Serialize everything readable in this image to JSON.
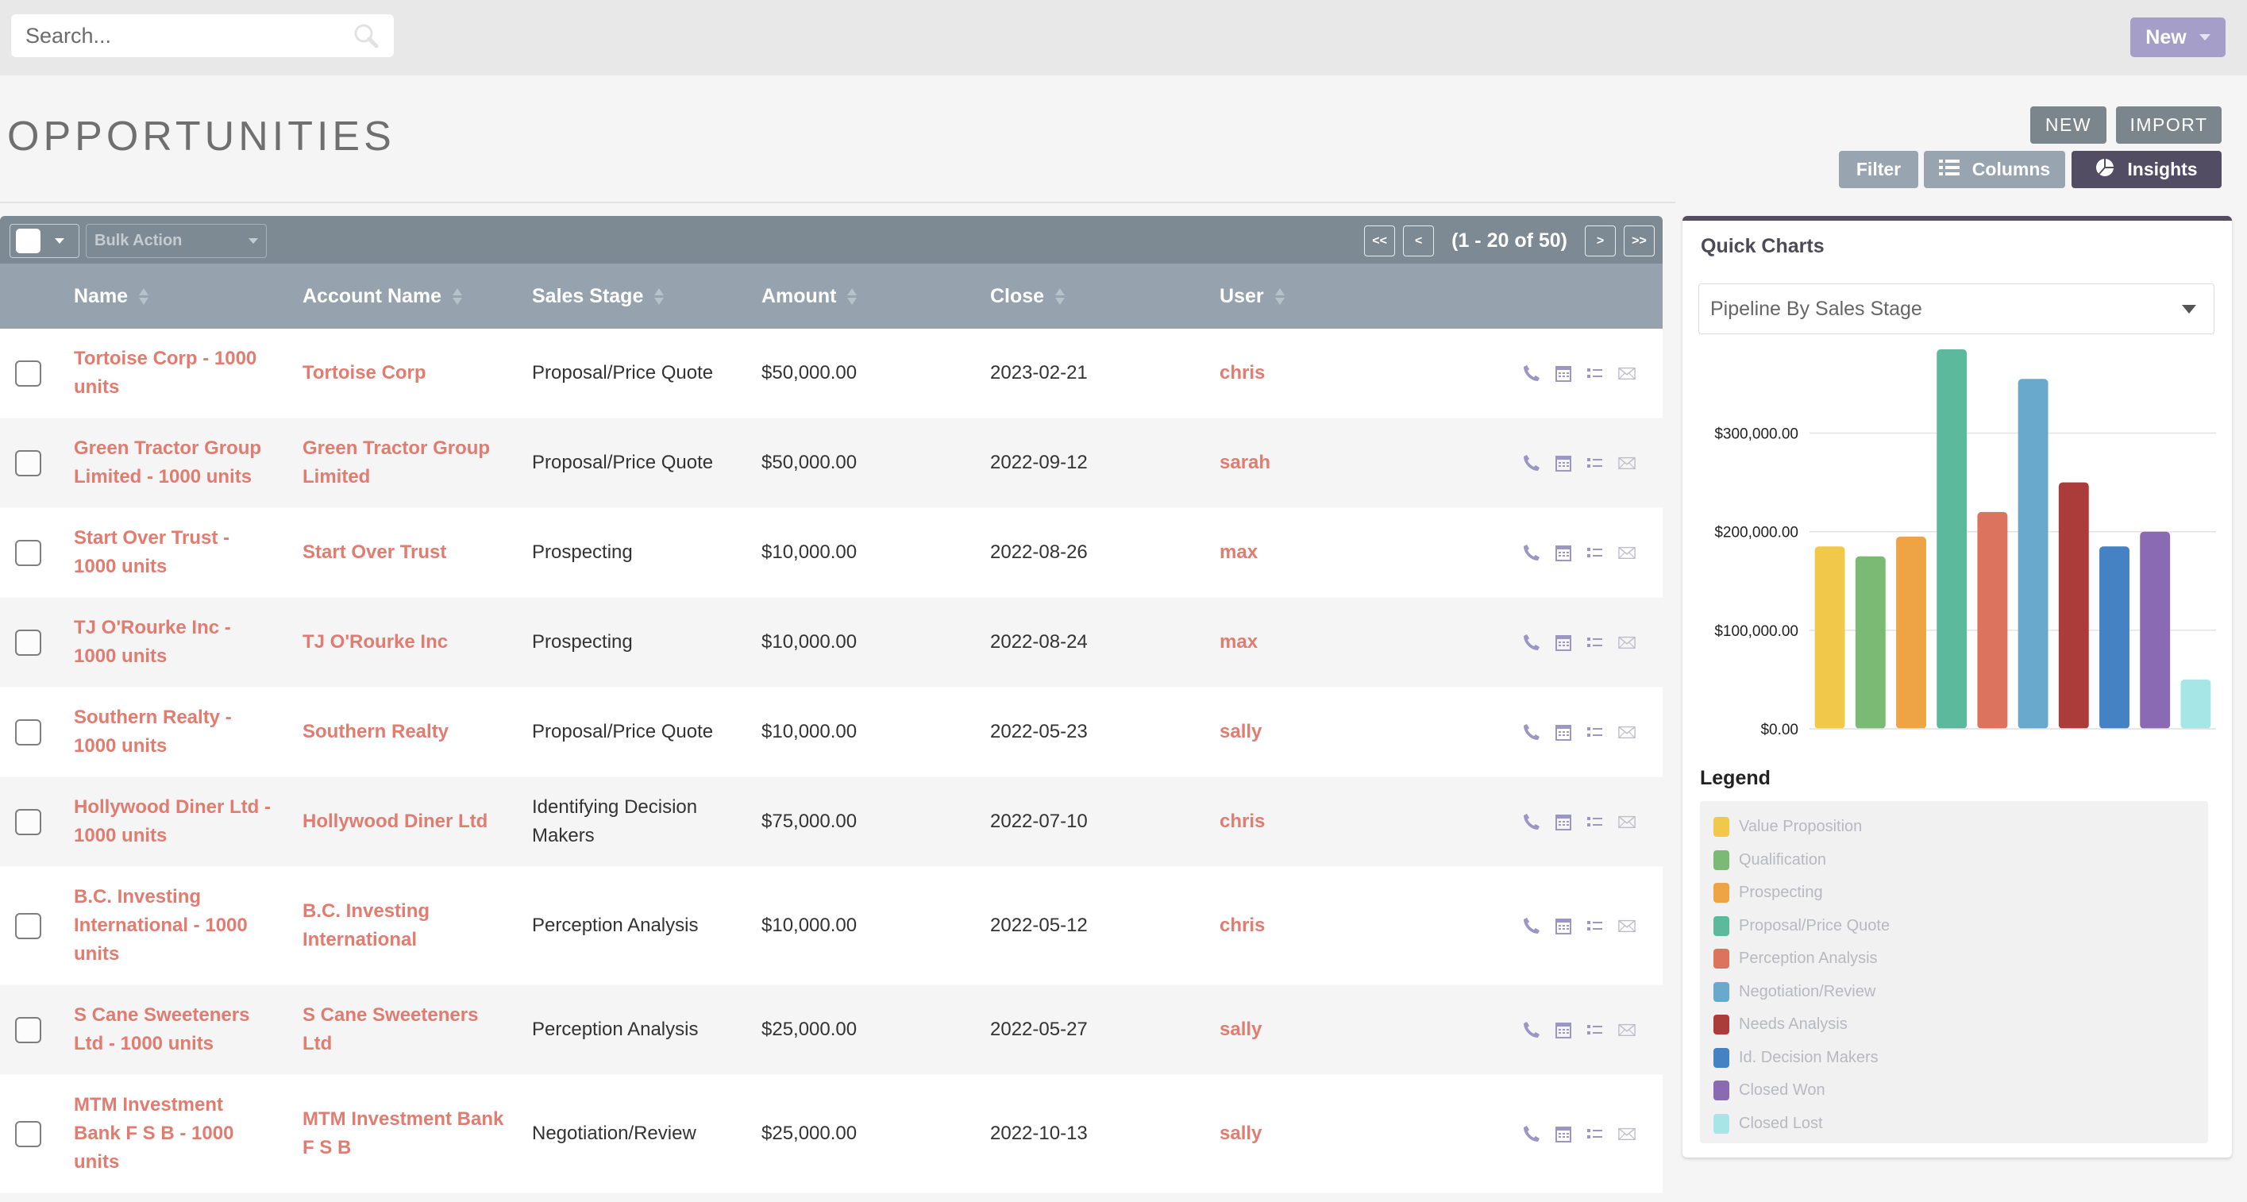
{
  "topbar": {
    "search_placeholder": "Search...",
    "new_label": "New"
  },
  "page": {
    "title": "OPPORTUNITIES",
    "buttons": {
      "new": "NEW",
      "import": "IMPORT",
      "filter": "Filter",
      "columns": "Columns",
      "insights": "Insights"
    }
  },
  "list": {
    "bulk_action": "Bulk Action",
    "pagination": {
      "first": "<<",
      "prev": "<",
      "count": "(1 - 20 of 50)",
      "next": ">",
      "last": ">>"
    },
    "columns": [
      "Name",
      "Account Name",
      "Sales Stage",
      "Amount",
      "Close",
      "User"
    ],
    "rows": [
      {
        "name": "Tortoise Corp - 1000 units",
        "account": "Tortoise Corp",
        "stage": "Proposal/Price Quote",
        "amount": "$50,000.00",
        "close": "2023-02-21",
        "user": "chris"
      },
      {
        "name": "Green Tractor Group Limited - 1000 units",
        "account": "Green Tractor Group Limited",
        "stage": "Proposal/Price Quote",
        "amount": "$50,000.00",
        "close": "2022-09-12",
        "user": "sarah"
      },
      {
        "name": "Start Over Trust - 1000 units",
        "account": "Start Over Trust",
        "stage": "Prospecting",
        "amount": "$10,000.00",
        "close": "2022-08-26",
        "user": "max"
      },
      {
        "name": "TJ O'Rourke Inc - 1000 units",
        "account": "TJ O'Rourke Inc",
        "stage": "Prospecting",
        "amount": "$10,000.00",
        "close": "2022-08-24",
        "user": "max"
      },
      {
        "name": "Southern Realty - 1000 units",
        "account": "Southern Realty",
        "stage": "Proposal/Price Quote",
        "amount": "$10,000.00",
        "close": "2022-05-23",
        "user": "sally"
      },
      {
        "name": "Hollywood Diner Ltd - 1000 units",
        "account": "Hollywood Diner Ltd",
        "stage": "Identifying Decision Makers",
        "amount": "$75,000.00",
        "close": "2022-07-10",
        "user": "chris"
      },
      {
        "name": "B.C. Investing International - 1000 units",
        "account": "B.C. Investing International",
        "stage": "Perception Analysis",
        "amount": "$10,000.00",
        "close": "2022-05-12",
        "user": "chris"
      },
      {
        "name": "S Cane Sweeteners Ltd - 1000 units",
        "account": "S Cane Sweeteners Ltd",
        "stage": "Perception Analysis",
        "amount": "$25,000.00",
        "close": "2022-05-27",
        "user": "sally"
      },
      {
        "name": "MTM Investment Bank F S B - 1000 units",
        "account": "MTM Investment Bank F S B",
        "stage": "Negotiation/Review",
        "amount": "$25,000.00",
        "close": "2022-10-13",
        "user": "sally"
      }
    ],
    "row_icons": [
      "phone-icon",
      "calendar-icon",
      "task-list-icon",
      "envelope-icon"
    ]
  },
  "insights": {
    "title": "Quick Charts",
    "selected_chart": "Pipeline By Sales Stage",
    "legend_title": "Legend"
  },
  "colors": {
    "link": "#e07c70",
    "accent": "#534d64",
    "new_button": "#a59ec8",
    "icon": "#9c96c4"
  },
  "chart_data": {
    "type": "bar",
    "title": "Pipeline By Sales Stage",
    "xlabel": "",
    "ylabel": "",
    "ylim": [
      0,
      385000
    ],
    "yticks": [
      0,
      100000,
      200000,
      300000
    ],
    "ytick_labels": [
      "$0.00",
      "$100,000.00",
      "$200,000.00",
      "$300,000.00"
    ],
    "grid": true,
    "legend_position": "bottom",
    "categories": [
      "Value Proposition",
      "Qualification",
      "Prospecting",
      "Proposal/Price Quote",
      "Perception Analysis",
      "Negotiation/Review",
      "Needs Analysis",
      "Id. Decision Makers",
      "Closed Won",
      "Closed Lost"
    ],
    "values": [
      185000,
      175000,
      195000,
      385000,
      220000,
      355000,
      250000,
      185000,
      200000,
      50000
    ],
    "colors": [
      "#f2c84b",
      "#7aba74",
      "#eea344",
      "#5cb99c",
      "#dc735f",
      "#69aacc",
      "#ab3c3a",
      "#4582c3",
      "#8a6bb3",
      "#a6e6e6"
    ]
  }
}
